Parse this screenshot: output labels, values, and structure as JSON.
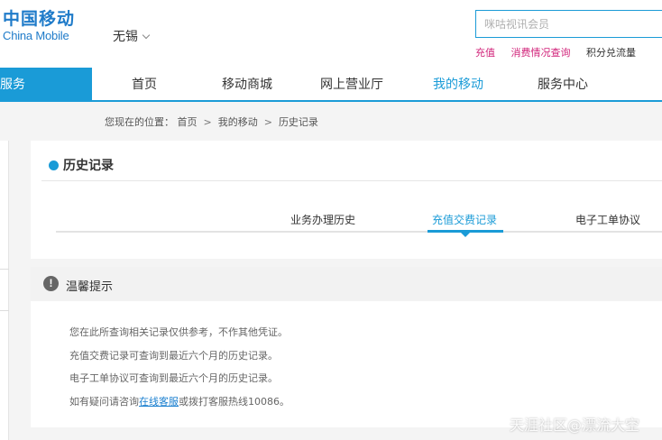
{
  "header": {
    "logo_cn": "中国移动",
    "logo_en": "China Mobile",
    "city": "无锡",
    "search_placeholder": "咪咕视讯会员",
    "quick_links": [
      "充值",
      "消费情况查询",
      "积分兑流量"
    ]
  },
  "nav": {
    "service_label": "服务",
    "items": [
      "首页",
      "移动商城",
      "网上营业厅",
      "我的移动",
      "服务中心"
    ],
    "active_index": 3
  },
  "breadcrumb": {
    "prefix": "您现在的位置：",
    "items": [
      "首页",
      "我的移动",
      "历史记录"
    ],
    "separator": ">"
  },
  "history": {
    "title": "历史记录",
    "tabs": [
      "业务办理历史",
      "充值交费记录",
      "电子工单协议"
    ],
    "active_tab": 1
  },
  "tips": {
    "title": "温馨提示",
    "lines": [
      "您在此所查询相关记录仅供参考，不作其他凭证。",
      "充值交费记录可查询到最近六个月的历史记录。",
      "电子工单协议可查询到最近六个月的历史记录。"
    ],
    "last_prefix": "如有疑问请咨询",
    "last_link": "在线客服",
    "last_suffix": "或拨打客服热线10086。"
  },
  "watermark": "天涯社区@漂流大空",
  "colors": {
    "accent": "#1a9bd7",
    "brand": "#1f7bc9",
    "link_pink": "#d1237a"
  }
}
